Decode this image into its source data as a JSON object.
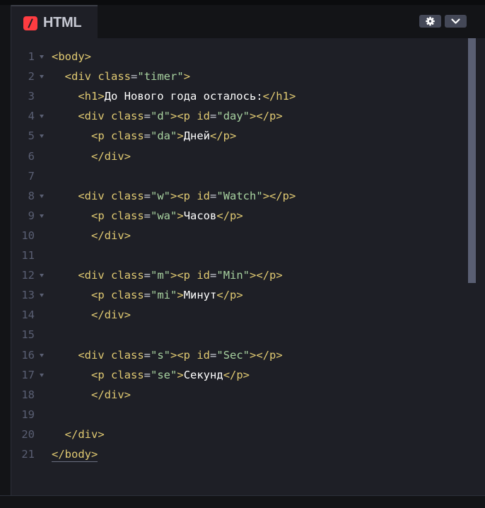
{
  "editor": {
    "language_label": "HTML",
    "icons": {
      "logo": "codepen-html-logo-icon",
      "settings": "gear-icon",
      "collapse": "chevron-down-icon"
    },
    "colors": {
      "background": "#1e1f26",
      "tag": "#e1ca72",
      "attribute_value": "#a8d2a0",
      "text": "#ffffff",
      "line_number": "#5a5f73",
      "logo": "#ff3c41"
    }
  },
  "code": {
    "line_numbers": [
      "1",
      "2",
      "3",
      "4",
      "5",
      "6",
      "7",
      "8",
      "9",
      "10",
      "11",
      "12",
      "13",
      "14",
      "15",
      "16",
      "17",
      "18",
      "19",
      "20",
      "21"
    ],
    "lines": [
      {
        "parts": [
          {
            "k": "tag",
            "t": "<body>"
          }
        ]
      },
      {
        "parts": [
          {
            "k": "ws",
            "t": "  "
          },
          {
            "k": "tag",
            "t": "<div "
          },
          {
            "k": "attr",
            "t": "class"
          },
          {
            "k": "eq",
            "t": "="
          },
          {
            "k": "val",
            "t": "\"timer\""
          },
          {
            "k": "tag",
            "t": ">"
          }
        ]
      },
      {
        "parts": [
          {
            "k": "ws",
            "t": "    "
          },
          {
            "k": "tag",
            "t": "<h1>"
          },
          {
            "k": "text",
            "t": "До Нового года осталось:"
          },
          {
            "k": "tag",
            "t": "</h1>"
          }
        ]
      },
      {
        "parts": [
          {
            "k": "ws",
            "t": "    "
          },
          {
            "k": "tag",
            "t": "<div "
          },
          {
            "k": "attr",
            "t": "class"
          },
          {
            "k": "eq",
            "t": "="
          },
          {
            "k": "val",
            "t": "\"d\""
          },
          {
            "k": "tag",
            "t": "><p "
          },
          {
            "k": "attr",
            "t": "id"
          },
          {
            "k": "eq",
            "t": "="
          },
          {
            "k": "val",
            "t": "\"day\""
          },
          {
            "k": "tag",
            "t": "></p>"
          }
        ]
      },
      {
        "parts": [
          {
            "k": "ws",
            "t": "      "
          },
          {
            "k": "tag",
            "t": "<p "
          },
          {
            "k": "attr",
            "t": "class"
          },
          {
            "k": "eq",
            "t": "="
          },
          {
            "k": "val",
            "t": "\"da\""
          },
          {
            "k": "tag",
            "t": ">"
          },
          {
            "k": "text",
            "t": "Дней"
          },
          {
            "k": "tag",
            "t": "</p>"
          }
        ]
      },
      {
        "parts": [
          {
            "k": "ws",
            "t": "      "
          },
          {
            "k": "tag",
            "t": "</div>"
          }
        ]
      },
      {
        "parts": []
      },
      {
        "parts": [
          {
            "k": "ws",
            "t": "    "
          },
          {
            "k": "tag",
            "t": "<div "
          },
          {
            "k": "attr",
            "t": "class"
          },
          {
            "k": "eq",
            "t": "="
          },
          {
            "k": "val",
            "t": "\"w\""
          },
          {
            "k": "tag",
            "t": "><p "
          },
          {
            "k": "attr",
            "t": "id"
          },
          {
            "k": "eq",
            "t": "="
          },
          {
            "k": "val",
            "t": "\"Watch\""
          },
          {
            "k": "tag",
            "t": "></p>"
          }
        ]
      },
      {
        "parts": [
          {
            "k": "ws",
            "t": "      "
          },
          {
            "k": "tag",
            "t": "<p "
          },
          {
            "k": "attr",
            "t": "class"
          },
          {
            "k": "eq",
            "t": "="
          },
          {
            "k": "val",
            "t": "\"wa\""
          },
          {
            "k": "tag",
            "t": ">"
          },
          {
            "k": "text",
            "t": "Часов"
          },
          {
            "k": "tag",
            "t": "</p>"
          }
        ]
      },
      {
        "parts": [
          {
            "k": "ws",
            "t": "      "
          },
          {
            "k": "tag",
            "t": "</div>"
          }
        ]
      },
      {
        "parts": []
      },
      {
        "parts": [
          {
            "k": "ws",
            "t": "    "
          },
          {
            "k": "tag",
            "t": "<div "
          },
          {
            "k": "attr",
            "t": "class"
          },
          {
            "k": "eq",
            "t": "="
          },
          {
            "k": "val",
            "t": "\"m\""
          },
          {
            "k": "tag",
            "t": "><p "
          },
          {
            "k": "attr",
            "t": "id"
          },
          {
            "k": "eq",
            "t": "="
          },
          {
            "k": "val",
            "t": "\"Min\""
          },
          {
            "k": "tag",
            "t": "></p>"
          }
        ]
      },
      {
        "parts": [
          {
            "k": "ws",
            "t": "      "
          },
          {
            "k": "tag",
            "t": "<p "
          },
          {
            "k": "attr",
            "t": "class"
          },
          {
            "k": "eq",
            "t": "="
          },
          {
            "k": "val",
            "t": "\"mi\""
          },
          {
            "k": "tag",
            "t": ">"
          },
          {
            "k": "text",
            "t": "Минут"
          },
          {
            "k": "tag",
            "t": "</p>"
          }
        ]
      },
      {
        "parts": [
          {
            "k": "ws",
            "t": "      "
          },
          {
            "k": "tag",
            "t": "</div>"
          }
        ]
      },
      {
        "parts": []
      },
      {
        "parts": [
          {
            "k": "ws",
            "t": "    "
          },
          {
            "k": "tag",
            "t": "<div "
          },
          {
            "k": "attr",
            "t": "class"
          },
          {
            "k": "eq",
            "t": "="
          },
          {
            "k": "val",
            "t": "\"s\""
          },
          {
            "k": "tag",
            "t": "><p "
          },
          {
            "k": "attr",
            "t": "id"
          },
          {
            "k": "eq",
            "t": "="
          },
          {
            "k": "val",
            "t": "\"Sec\""
          },
          {
            "k": "tag",
            "t": "></p>"
          }
        ]
      },
      {
        "parts": [
          {
            "k": "ws",
            "t": "      "
          },
          {
            "k": "tag",
            "t": "<p "
          },
          {
            "k": "attr",
            "t": "class"
          },
          {
            "k": "eq",
            "t": "="
          },
          {
            "k": "val",
            "t": "\"se\""
          },
          {
            "k": "tag",
            "t": ">"
          },
          {
            "k": "text",
            "t": "Секунд"
          },
          {
            "k": "tag",
            "t": "</p>"
          }
        ]
      },
      {
        "parts": [
          {
            "k": "ws",
            "t": "      "
          },
          {
            "k": "tag",
            "t": "</div>"
          }
        ]
      },
      {
        "parts": []
      },
      {
        "parts": [
          {
            "k": "ws",
            "t": "  "
          },
          {
            "k": "tag",
            "t": "</div>"
          }
        ]
      },
      {
        "parts": [
          {
            "k": "tag",
            "t": "</body>"
          }
        ]
      }
    ],
    "foldable_lines": [
      1,
      2,
      4,
      5,
      8,
      9,
      12,
      13,
      16,
      17
    ]
  }
}
